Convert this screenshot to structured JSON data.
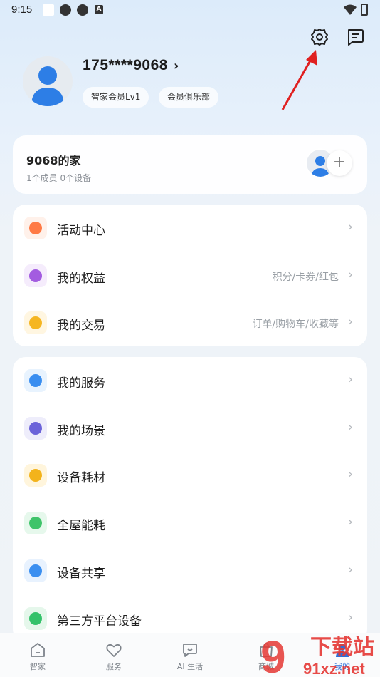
{
  "status_bar": {
    "time": "9:15",
    "a_glyph": "A"
  },
  "header": {
    "settings_icon": "gear-icon",
    "message_icon": "message-icon"
  },
  "profile": {
    "phone": "175****9068",
    "chevron": "›",
    "member_level": "智家会员Lv1",
    "club": "会员俱乐部"
  },
  "home": {
    "title": "9068的家",
    "subtitle": "1个成员  0个设备",
    "add_symbol": "+"
  },
  "group1": [
    {
      "label": "活动中心",
      "hint": "",
      "icon": "gift-icon",
      "color": "#ff7a45",
      "bg": "#fff1ea"
    },
    {
      "label": "我的权益",
      "hint": "积分/卡券/红包",
      "icon": "diamond-icon",
      "color": "#a35ce0",
      "bg": "#f5ecfc"
    },
    {
      "label": "我的交易",
      "hint": "订单/购物车/收藏等",
      "icon": "coin-icon",
      "color": "#f5b623",
      "bg": "#fff6e1"
    }
  ],
  "group2": [
    {
      "label": "我的服务",
      "hint": "",
      "icon": "heart-icon",
      "color": "#3a8ef0",
      "bg": "#e8f3fe"
    },
    {
      "label": "我的场景",
      "hint": "",
      "icon": "layers-icon",
      "color": "#6b63d9",
      "bg": "#eeedfb"
    },
    {
      "label": "设备耗材",
      "hint": "",
      "icon": "refresh-icon",
      "color": "#f3b31b",
      "bg": "#fff5dc"
    },
    {
      "label": "全屋能耗",
      "hint": "",
      "icon": "lightning-icon",
      "color": "#3fc46a",
      "bg": "#e6f8ec"
    },
    {
      "label": "设备共享",
      "hint": "",
      "icon": "share-icon",
      "color": "#3b8ff0",
      "bg": "#e8f2fe"
    },
    {
      "label": "第三方平台设备",
      "hint": "",
      "icon": "link-icon",
      "color": "#34c26a",
      "bg": "#e5f7eb"
    }
  ],
  "row_chevron": "›",
  "bottom_nav": [
    {
      "label": "智家",
      "icon": "house-icon"
    },
    {
      "label": "服务",
      "icon": "heart-icon"
    },
    {
      "label": "AI 生活",
      "icon": "chat-icon"
    },
    {
      "label": "商城",
      "icon": "bag-icon"
    },
    {
      "label": "我的",
      "icon": "person-icon"
    }
  ],
  "watermark": {
    "top": "下载站",
    "bottom": "91xz.net",
    "number": "9"
  }
}
